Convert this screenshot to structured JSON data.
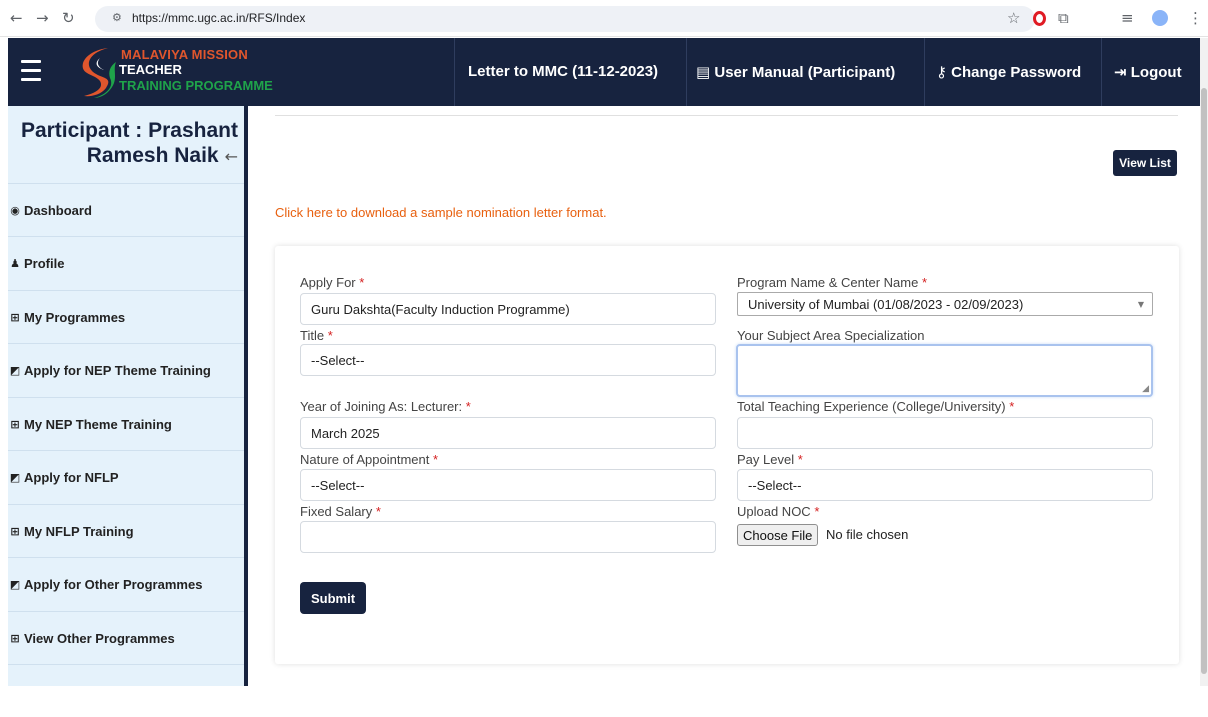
{
  "browser": {
    "url": "https://mmc.ugc.ac.in/RFS/Index"
  },
  "brand": {
    "line1": "MALAVIYA MISSION",
    "line2": "TEACHER",
    "line3": "TRAINING PROGRAMME"
  },
  "navbar": {
    "letter": "Letter to MMC (11-12-2023)",
    "manual": "User Manual (Participant)",
    "change_password": "Change Password",
    "logout": "Logout"
  },
  "sidebar": {
    "participant_line1": "Participant : Prashant",
    "participant_line2": "Ramesh Naik",
    "items": [
      {
        "label": "Dashboard",
        "icon": "dashboard-icon"
      },
      {
        "label": "Profile",
        "icon": "user-icon"
      },
      {
        "label": "My Programmes",
        "icon": "grid-icon"
      },
      {
        "label": "Apply for NEP Theme Training",
        "icon": "share-icon"
      },
      {
        "label": "My NEP Theme Training",
        "icon": "grid-icon"
      },
      {
        "label": "Apply for NFLP",
        "icon": "share-icon"
      },
      {
        "label": "My NFLP Training",
        "icon": "grid-icon"
      },
      {
        "label": "Apply for Other Programmes",
        "icon": "share-icon"
      },
      {
        "label": "View Other Programmes",
        "icon": "grid-icon"
      }
    ]
  },
  "main": {
    "view_list": "View List",
    "download_link": "Click here to download a sample nomination letter format.",
    "submit": "Submit"
  },
  "form": {
    "apply_for": {
      "label": "Apply For",
      "value": "Guru Dakshta(Faculty Induction Programme)"
    },
    "program_center": {
      "label": "Program Name & Center Name",
      "value": "University of Mumbai (01/08/2023 - 02/09/2023)"
    },
    "title": {
      "label": "Title",
      "value": "--Select--"
    },
    "subject_area": {
      "label": "Your Subject Area Specialization",
      "value": ""
    },
    "year_joining": {
      "label": "Year of Joining As: Lecturer:",
      "value": "March 2025"
    },
    "teaching_experience": {
      "label": "Total Teaching Experience (College/University)",
      "value": ""
    },
    "nature_appointment": {
      "label": "Nature of Appointment",
      "value": "--Select--"
    },
    "pay_level": {
      "label": "Pay Level",
      "value": "--Select--"
    },
    "fixed_salary": {
      "label": "Fixed Salary",
      "value": ""
    },
    "upload_noc": {
      "label": "Upload NOC",
      "button": "Choose File",
      "status": "No file chosen"
    }
  },
  "colors": {
    "navy": "#17233f",
    "accent_orange": "#e8600f",
    "sidebar_bg": "#e5f2fb",
    "required": "#d41f1f"
  }
}
